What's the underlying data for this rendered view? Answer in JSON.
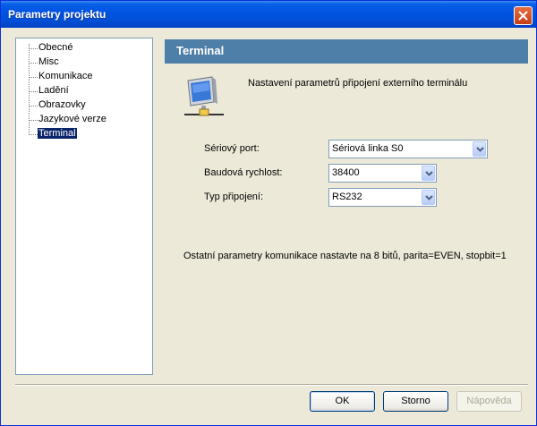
{
  "window": {
    "title": "Parametry projektu"
  },
  "tree": {
    "items": [
      "Obecné",
      "Misc",
      "Komunikace",
      "Ladění",
      "Obrazovky",
      "Jazykové verze",
      "Terminal"
    ],
    "selected": "Terminal"
  },
  "panel": {
    "title": "Terminal",
    "description": "Nastavení parametrů připojení externího terminálu",
    "fields": [
      {
        "label": "Sériový port:",
        "value": "Sériová linka S0"
      },
      {
        "label": "Baudová rychlost:",
        "value": "38400"
      },
      {
        "label": "Typ připojení:",
        "value": "RS232"
      }
    ],
    "note": "Ostatní parametry komunikace nastavte na 8 bitů, parita=EVEN, stopbit=1"
  },
  "buttons": {
    "ok": "OK",
    "cancel": "Storno",
    "help": "Nápověda"
  },
  "colors": {
    "titlebar": "#0054e3",
    "panel_header": "#4e7fa8",
    "selection": "#0a246a"
  }
}
